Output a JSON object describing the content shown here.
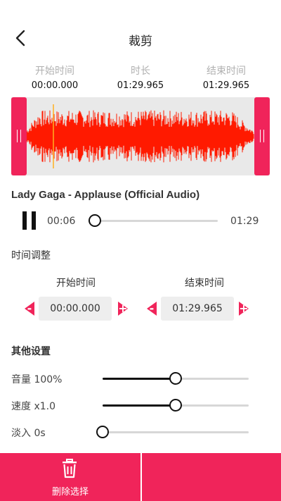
{
  "header": {
    "title": "裁剪",
    "back_icon": "chevron-left-icon"
  },
  "times": {
    "start": {
      "label": "开始时间",
      "value": "00:00.000"
    },
    "length": {
      "label": "时长",
      "value": "01:29.965"
    },
    "end": {
      "label": "结束时间",
      "value": "01:29.965"
    }
  },
  "waveform": {
    "color": "#ff1a00",
    "handle_color": "#f0245a",
    "background": "#e9e9e9",
    "selection_start_fraction": 0,
    "selection_end_fraction": 1
  },
  "player": {
    "song_title": "Lady Gaga - Applause (Official Audio)",
    "position": "00:06",
    "duration": "01:29",
    "progress_fraction": 0.05,
    "state_icon": "pause-icon"
  },
  "time_adjust": {
    "title": "时间调整",
    "start": {
      "label": "开始时间",
      "value": "00:00.000",
      "minus": "-",
      "plus": "+"
    },
    "end": {
      "label": "结束时间",
      "value": "01:29.965",
      "minus": "-",
      "plus": "+"
    }
  },
  "other_settings": {
    "title": "其他设置",
    "volume": {
      "label": "音量 100%",
      "level_fraction": 0.5
    },
    "speed": {
      "label": "速度 x1.0",
      "level_fraction": 0.5
    },
    "fade_in": {
      "label": "淡入 0s",
      "level_fraction": 0
    }
  },
  "bottom_bar": {
    "delete_label": "删除选择",
    "delete_icon": "trash-icon",
    "accent": "#f0245a"
  }
}
